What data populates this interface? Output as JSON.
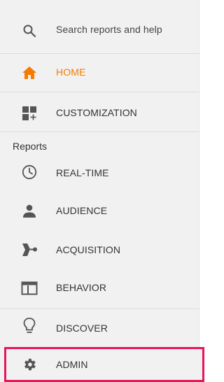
{
  "search": {
    "placeholder": "Search reports and help",
    "icon": "search-icon"
  },
  "nav": {
    "home": {
      "label": "HOME",
      "icon": "home-icon",
      "color": "#f57c00"
    },
    "customization": {
      "label": "CUSTOMIZATION",
      "icon": "customization-icon"
    }
  },
  "reports": {
    "title": "Reports",
    "items": [
      {
        "label": "REAL-TIME",
        "icon": "clock-icon"
      },
      {
        "label": "AUDIENCE",
        "icon": "person-icon"
      },
      {
        "label": "ACQUISITION",
        "icon": "acquisition-icon"
      },
      {
        "label": "BEHAVIOR",
        "icon": "behavior-icon"
      }
    ]
  },
  "bottom": {
    "discover": {
      "label": "DISCOVER",
      "icon": "lightbulb-icon"
    },
    "admin": {
      "label": "ADMIN",
      "icon": "gear-icon",
      "highlight_color": "#e8155c"
    }
  }
}
